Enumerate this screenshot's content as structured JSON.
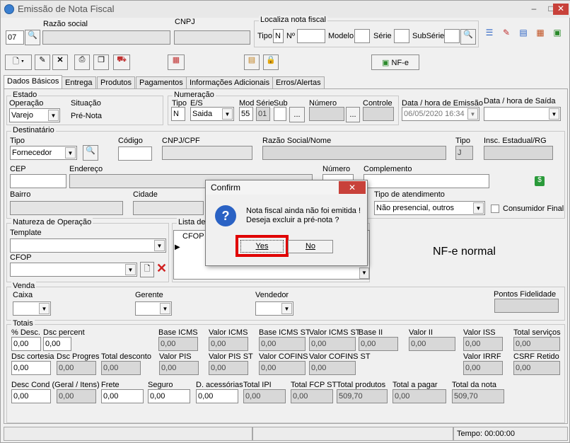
{
  "window": {
    "title": "Emissão de Nota Fiscal",
    "minimize": "–",
    "maximize": "□",
    "close": "✕"
  },
  "header": {
    "codigo_value": "07",
    "razao_social_label": "Razão social",
    "cnpj_label": "CNPJ",
    "localiza_caption": "Localiza nota fiscal",
    "tipo_label": "Tipo",
    "tipo_value": "N",
    "no_label": "Nº",
    "modelo_label": "Modelo",
    "serie_label": "Série",
    "subserie_label": "SubSérie"
  },
  "toolbar": {
    "nfe_button": "NF-e"
  },
  "tabs": [
    "Dados Básicos",
    "Entrega",
    "Produtos",
    "Pagamentos",
    "Informações Adicionais",
    "Erros/Alertas"
  ],
  "estado": {
    "caption": "Estado",
    "operacao_label": "Operação",
    "operacao_value": "Varejo",
    "situacao_label": "Situação",
    "situacao_value": "Pré-Nota"
  },
  "numeracao": {
    "caption": "Numeração",
    "tipo_label": "Tipo",
    "tipo_value": "N",
    "es_label": "E/S",
    "es_value": "Saida",
    "mod_label": "Mod",
    "mod_value": "55",
    "serie_label": "Série",
    "serie_value": "01",
    "sub_label": "Sub",
    "numero_label": "Número",
    "controle_label": "Controle",
    "dots": "..."
  },
  "emissao": {
    "label": "Data / hora de Emissão",
    "value": "06/05/2020 16:34"
  },
  "saida": {
    "label": "Data / hora de Saída"
  },
  "destinatario": {
    "caption": "Destinatário",
    "tipo_label": "Tipo",
    "tipo_value": "Fornecedor",
    "codigo_label": "Código",
    "cnpj_label": "CNPJ/CPF",
    "razao_label": "Razão Social/Nome",
    "tipo2_label": "Tipo",
    "tipo2_value": "J",
    "insc_label": "Insc. Estadual/RG",
    "cep_label": "CEP",
    "endereco_label": "Endereço",
    "numero_label": "Número",
    "complemento_label": "Complemento",
    "bairro_label": "Bairro",
    "cidade_label": "Cidade",
    "atendimento_label": "Tipo de atendimento",
    "atendimento_value": "Não presencial, outros",
    "consumidor_label": "Consumidor Final"
  },
  "natureza": {
    "caption": "Natureza de Operação",
    "template_label": "Template",
    "cfop_label": "CFOP",
    "lista_label": "Lista de",
    "lista_col": "CFOP"
  },
  "nfe_normal": "NF-e normal",
  "venda": {
    "caption": "Venda",
    "caixa_label": "Caixa",
    "gerente_label": "Gerente",
    "vendedor_label": "Vendedor",
    "pontos_label": "Pontos Fidelidade"
  },
  "totais": {
    "caption": "Totais",
    "row1": [
      {
        "label": "% Desc.",
        "value": "0,00"
      },
      {
        "label": "Dsc percent",
        "value": "0,00"
      },
      {
        "label": "Base ICMS",
        "value": "0,00"
      },
      {
        "label": "Valor ICMS",
        "value": "0,00"
      },
      {
        "label": "Base ICMS ST",
        "value": "0,00"
      },
      {
        "label": "Valor ICMS ST",
        "value": "0,00"
      },
      {
        "label": "Base II",
        "value": "0,00"
      },
      {
        "label": "Valor II",
        "value": "0,00"
      },
      {
        "label": "Valor ISS",
        "value": "0,00"
      },
      {
        "label": "Total serviços",
        "value": "0,00"
      }
    ],
    "row2": [
      {
        "label": "Dsc cortesia",
        "value": "0,00"
      },
      {
        "label": "Dsc Progres",
        "value": "0,00"
      },
      {
        "label": "Total desconto",
        "value": "0,00"
      },
      {
        "label": "Valor PIS",
        "value": "0,00"
      },
      {
        "label": "Valor PIS ST",
        "value": "0,00"
      },
      {
        "label": "Valor COFINS",
        "value": "0,00"
      },
      {
        "label": "Valor COFINS ST",
        "value": "0,00"
      },
      {
        "label": "Valor IRRF",
        "value": "0,00"
      },
      {
        "label": "CSRF Retido",
        "value": "0,00"
      }
    ],
    "row3": [
      {
        "label": "Desc Cond (Geral / Itens)",
        "value": "0,00"
      },
      {
        "label": "",
        "value": "0,00"
      },
      {
        "label": "Frete",
        "value": "0,00"
      },
      {
        "label": "Seguro",
        "value": "0,00"
      },
      {
        "label": "D. acessórias",
        "value": "0,00"
      },
      {
        "label": "Total IPI",
        "value": "0,00"
      },
      {
        "label": "Total FCP ST",
        "value": "0,00"
      },
      {
        "label": "Total produtos",
        "value": "509,70"
      },
      {
        "label": "Total a pagar",
        "value": "0,00"
      },
      {
        "label": "Total da nota",
        "value": "509,70"
      }
    ]
  },
  "statusbar": {
    "tempo": "Tempo: 00:00:00"
  },
  "dialog": {
    "title": "Confirm",
    "message_line1": "Nota fiscal ainda não foi emitida !",
    "message_line2": "Deseja excluir a pré-nota ?",
    "yes": "Yes",
    "no": "No",
    "close": "✕",
    "question": "?"
  },
  "colors": {
    "highlight": "#e00000",
    "dialog_close": "#c8413a",
    "question_icon": "#2a62c4"
  }
}
